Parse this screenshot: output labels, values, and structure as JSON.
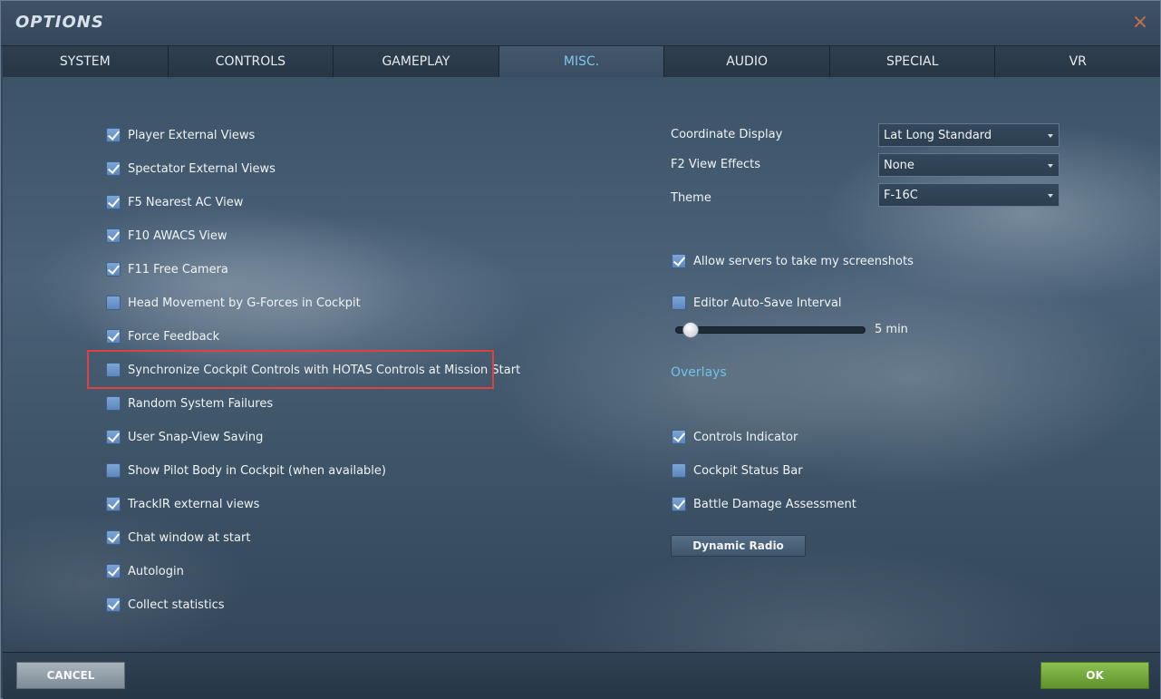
{
  "window": {
    "title": "OPTIONS",
    "close_glyph": "×"
  },
  "tabs": [
    {
      "label": "SYSTEM"
    },
    {
      "label": "CONTROLS"
    },
    {
      "label": "GAMEPLAY"
    },
    {
      "label": "MISC."
    },
    {
      "label": "AUDIO"
    },
    {
      "label": "SPECIAL"
    },
    {
      "label": "VR"
    }
  ],
  "active_tab": "MISC.",
  "left_options": [
    {
      "label": "Player External Views",
      "checked": true
    },
    {
      "label": "Spectator External Views",
      "checked": true
    },
    {
      "label": "F5 Nearest AC View",
      "checked": true
    },
    {
      "label": "F10 AWACS View",
      "checked": true
    },
    {
      "label": "F11 Free Camera",
      "checked": true
    },
    {
      "label": "Head Movement by G-Forces in Cockpit",
      "checked": false
    },
    {
      "label": "Force Feedback",
      "checked": true
    },
    {
      "label": "Synchronize Cockpit Controls with HOTAS Controls at Mission Start",
      "checked": false
    },
    {
      "label": "Random System Failures",
      "checked": false
    },
    {
      "label": "User Snap-View Saving",
      "checked": true
    },
    {
      "label": "Show Pilot Body in Cockpit (when available)",
      "checked": false
    },
    {
      "label": "TrackIR external views",
      "checked": true
    },
    {
      "label": "Chat window at start",
      "checked": true
    },
    {
      "label": "Autologin",
      "checked": true
    },
    {
      "label": "Collect statistics",
      "checked": true
    }
  ],
  "selects": {
    "coordinate_display": {
      "label": "Coordinate Display",
      "value": "Lat Long Standard"
    },
    "f2_view_effects": {
      "label": "F2 View Effects",
      "value": "None"
    },
    "theme": {
      "label": "Theme",
      "value": "F-16C"
    }
  },
  "right_options": {
    "allow_screenshots": {
      "label": "Allow servers to take my screenshots",
      "checked": true
    },
    "editor_autosave": {
      "label": "Editor Auto-Save Interval",
      "checked": false
    }
  },
  "autosave_slider": {
    "value_label": "5 min",
    "level": 0.1
  },
  "overlays": {
    "title": "Overlays",
    "items": [
      {
        "label": "Controls Indicator",
        "checked": true
      },
      {
        "label": "Cockpit Status Bar",
        "checked": false
      },
      {
        "label": "Battle Damage Assessment",
        "checked": true
      }
    ]
  },
  "buttons": {
    "dynamic_radio": "Dynamic Radio",
    "cancel": "CANCEL",
    "ok": "OK"
  },
  "colors": {
    "accent": "#6fc3ea",
    "checkbox": "#6a93c8",
    "ok": "#6fa338",
    "highlight": "#e04040"
  }
}
